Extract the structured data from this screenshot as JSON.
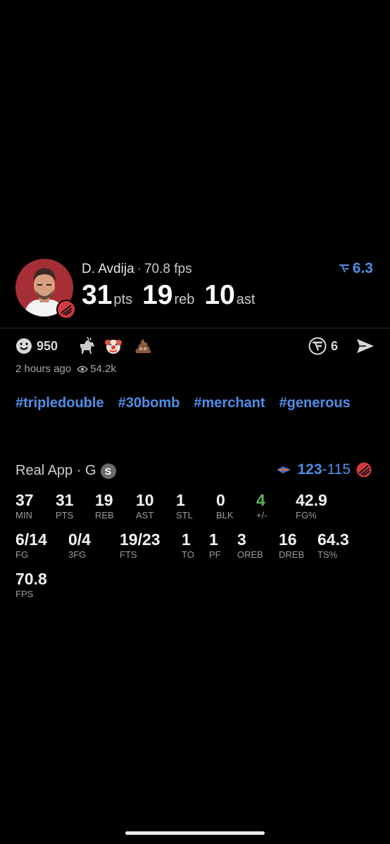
{
  "player": {
    "name": "D. Avdija",
    "fps_label": "70.8 fps",
    "rating": "6.3",
    "headline": [
      {
        "value": "31",
        "unit": "pts"
      },
      {
        "value": "19",
        "unit": "reb"
      },
      {
        "value": "10",
        "unit": "ast"
      }
    ]
  },
  "reactions": {
    "smile_count": "950",
    "share_count": "6",
    "posted": "2 hours ago",
    "views": "54.2k"
  },
  "tags": [
    "#tripledouble",
    "#30bomb",
    "#merchant",
    "#generous"
  ],
  "box": {
    "source": "Real App · G",
    "source_badge": "S",
    "score_won": "123",
    "score_sep": "-",
    "score_lost": "115",
    "rows": [
      [
        {
          "v": "37",
          "l": "MIN"
        },
        {
          "v": "31",
          "l": "PTS"
        },
        {
          "v": "19",
          "l": "REB"
        },
        {
          "v": "10",
          "l": "AST"
        },
        {
          "v": "1",
          "l": "STL"
        },
        {
          "v": "0",
          "l": "BLK"
        },
        {
          "v": "4",
          "l": "+/-"
        },
        {
          "v": "42.9",
          "l": "FG%"
        }
      ],
      [
        {
          "v": "6/14",
          "l": "FG"
        },
        {
          "v": "0/4",
          "l": "3FG"
        },
        {
          "v": "19/23",
          "l": "FTS"
        },
        {
          "v": "1",
          "l": "TO"
        },
        {
          "v": "1",
          "l": "PF"
        },
        {
          "v": "3",
          "l": "OREB"
        },
        {
          "v": "16",
          "l": "DREB"
        },
        {
          "v": "64.3",
          "l": "TS%"
        }
      ],
      [
        {
          "v": "70.8",
          "l": "FPS"
        }
      ]
    ]
  },
  "colors": {
    "accent": "#4f8fe8",
    "positive": "#5fb35f",
    "background": "#000000"
  }
}
